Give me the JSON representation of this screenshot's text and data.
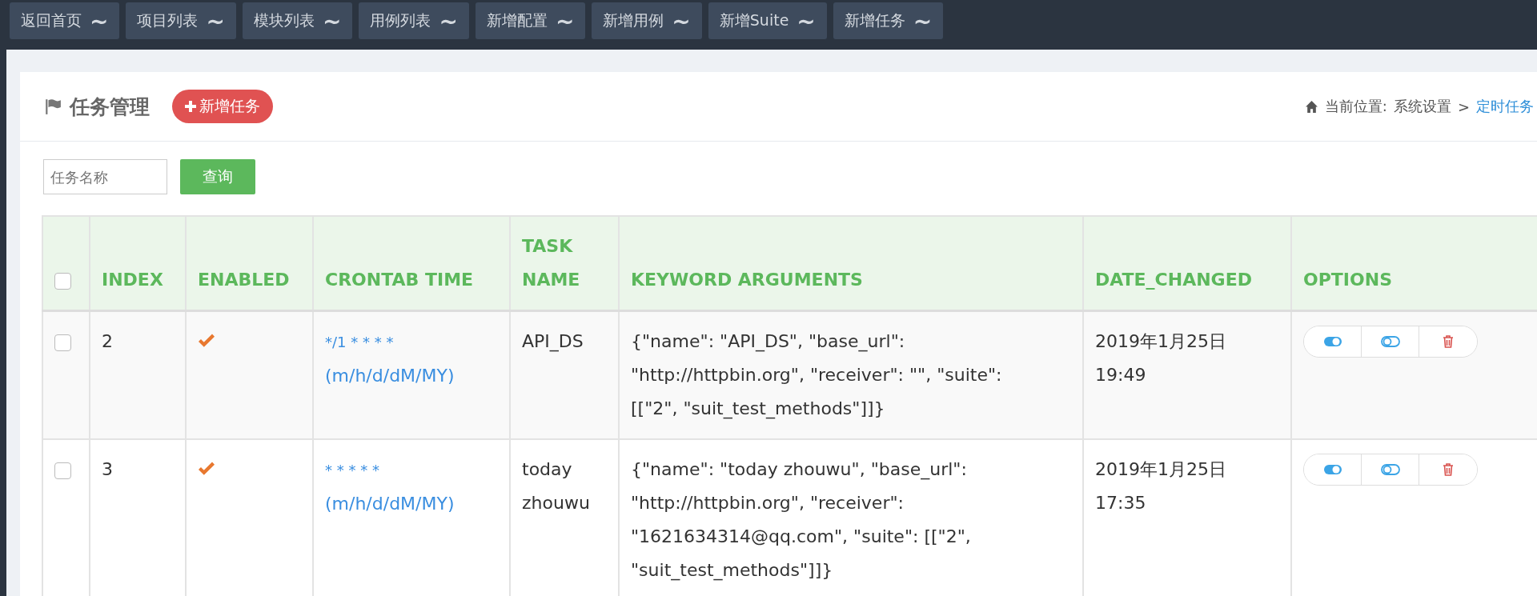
{
  "nav": [
    {
      "label": "返回首页",
      "symbol": "~"
    },
    {
      "label": "项目列表",
      "symbol": "~"
    },
    {
      "label": "模块列表",
      "symbol": "~"
    },
    {
      "label": "用例列表",
      "symbol": "~"
    },
    {
      "label": "新增配置",
      "symbol": "~"
    },
    {
      "label": "新增用例",
      "symbol": "~"
    },
    {
      "label": "新增Suite",
      "symbol": "~"
    },
    {
      "label": "新增任务",
      "symbol": "~"
    }
  ],
  "header": {
    "title": "任务管理",
    "add_button": "新增任务"
  },
  "breadcrumb": {
    "label": "当前位置:",
    "parent": "系统设置",
    "separator": ">",
    "current": "定时任务"
  },
  "search": {
    "placeholder": "任务名称",
    "button": "查询"
  },
  "table": {
    "select_all_checked": false,
    "columns": [
      "INDEX",
      "ENABLED",
      "CRONTAB TIME",
      "TASK NAME",
      "KEYWORD ARGUMENTS",
      "DATE_CHANGED",
      "OPTIONS"
    ],
    "rows": [
      {
        "checked": false,
        "index": "2",
        "enabled": true,
        "cron": "*/1 * * * *",
        "cron_unit": "(m/h/d/dM/MY)",
        "task_name": "API_DS",
        "kwargs": "{\"name\": \"API_DS\", \"base_url\": \"http://httpbin.org\", \"receiver\": \"\", \"suite\": [[\"2\", \"suit_test_methods\"]]}",
        "date_changed": "2019年1月25日 19:49"
      },
      {
        "checked": false,
        "index": "3",
        "enabled": true,
        "cron": "* * * * *",
        "cron_unit": "(m/h/d/dM/MY)",
        "task_name": "today zhouwu",
        "kwargs": "{\"name\": \"today zhouwu\", \"base_url\": \"http://httpbin.org\", \"receiver\": \"1621634314@qq.com\", \"suite\": [[\"2\", \"suit_test_methods\"]]}",
        "date_changed": "2019年1月25日 17:35"
      }
    ]
  }
}
